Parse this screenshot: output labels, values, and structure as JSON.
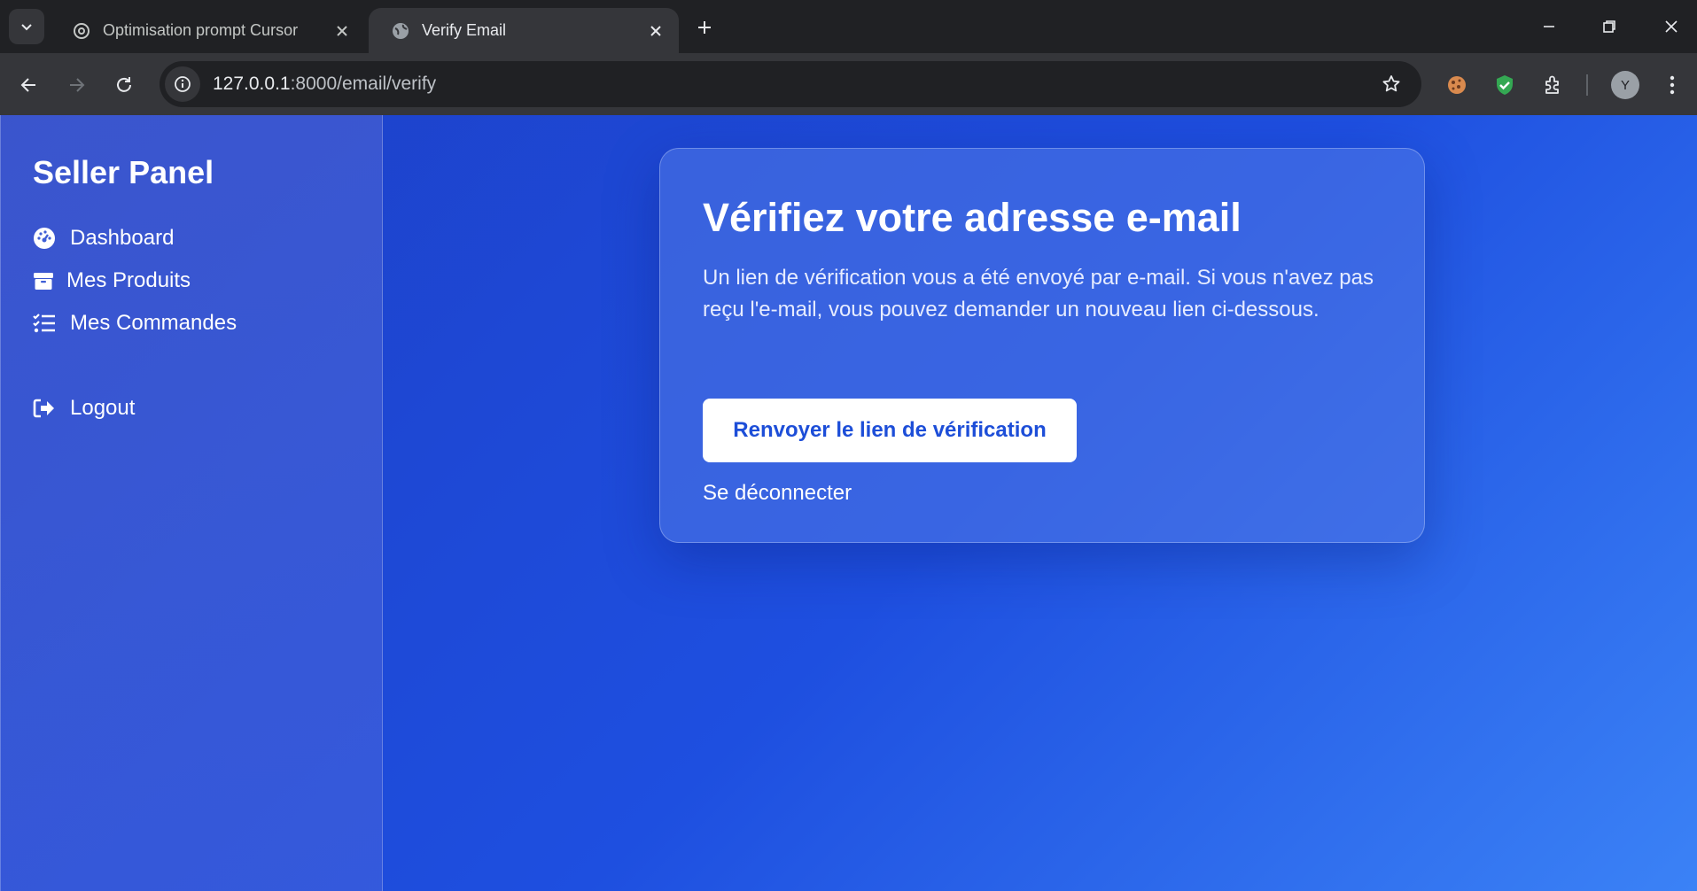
{
  "browser": {
    "tabs": [
      {
        "title": "Optimisation prompt Cursor",
        "favicon": "openai-icon",
        "active": false
      },
      {
        "title": "Verify Email",
        "favicon": "globe-icon",
        "active": true
      }
    ],
    "url_host": "127.0.0.1",
    "url_path": ":8000/email/verify",
    "profile_initial": "Y"
  },
  "sidebar": {
    "brand": "Seller Panel",
    "items": [
      {
        "label": "Dashboard",
        "icon": "gauge-icon"
      },
      {
        "label": "Mes Produits",
        "icon": "box-icon"
      },
      {
        "label": "Mes Commandes",
        "icon": "list-check-icon"
      }
    ],
    "logout_label": "Logout"
  },
  "card": {
    "title": "Vérifiez votre adresse e-mail",
    "message": "Un lien de vérification vous a été envoyé par e-mail. Si vous n'avez pas reçu l'e-mail, vous pouvez demander un nouveau lien ci-dessous.",
    "resend_label": "Renvoyer le lien de vérification",
    "logout_label": "Se déconnecter"
  },
  "colors": {
    "accent": "#1d4ed8",
    "background_start": "#1d3fc6",
    "background_end": "#3b82f6"
  }
}
